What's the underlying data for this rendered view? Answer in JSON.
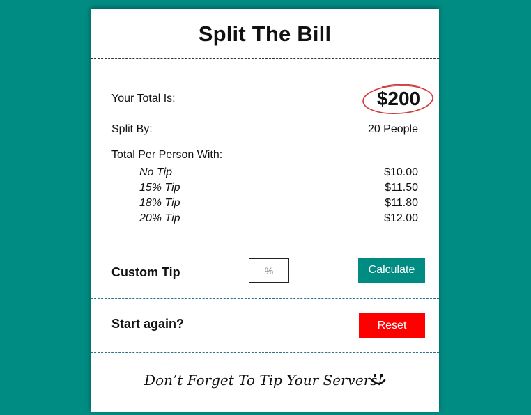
{
  "header": {
    "title": "Split The Bill"
  },
  "summary": {
    "total_label": "Your Total Is:",
    "total_value": "$200",
    "split_label": "Split By:",
    "split_value": "20 People",
    "per_person_label": "Total Per Person With:",
    "tips": [
      {
        "label": "No Tip",
        "value": "$10.00"
      },
      {
        "label": "15% Tip",
        "value": "$11.50"
      },
      {
        "label": "18% Tip",
        "value": "$11.80"
      },
      {
        "label": "20% Tip",
        "value": "$12.00"
      }
    ]
  },
  "custom_tip": {
    "label": "Custom Tip",
    "input_placeholder": "%",
    "input_value": "",
    "button_label": "Calculate"
  },
  "restart": {
    "label": "Start again?",
    "button_label": "Reset"
  },
  "footer": {
    "message": "Don’t Forget To Tip Your Servers!",
    "icon": "smiley-icon"
  },
  "colors": {
    "background": "#008b83",
    "calculate_button": "#008b83",
    "reset_button": "#ff0000",
    "total_circle": "#d23a3a"
  }
}
